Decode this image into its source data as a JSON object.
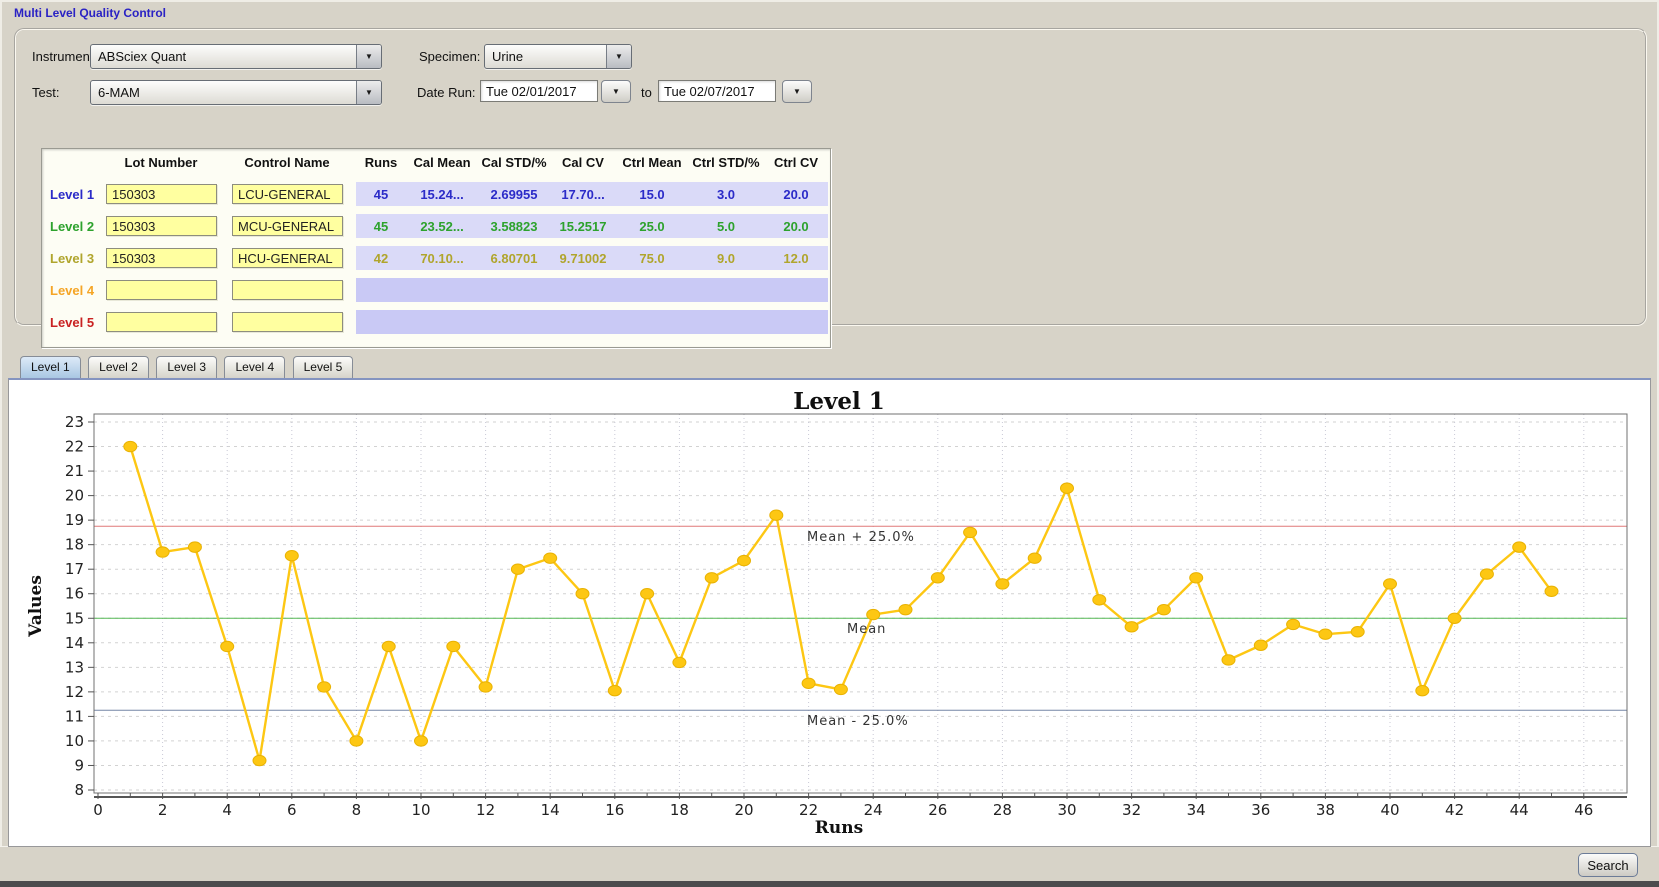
{
  "window": {
    "title": "Multi Level Quality Control"
  },
  "form": {
    "instrument_label": "Instrument:",
    "instrument_value": "ABSciex Quant",
    "specimen_label": "Specimen:",
    "specimen_value": "Urine",
    "test_label": "Test:",
    "test_value": "6-MAM",
    "date_run_label": "Date Run:",
    "date_from": "Tue 02/01/2017",
    "to_label": "to",
    "date_to": "Tue 02/07/2017"
  },
  "table": {
    "headers": [
      "Lot Number",
      "Control Name",
      "Runs",
      "Cal Mean",
      "Cal STD/%",
      "Cal CV",
      "Ctrl Mean",
      "Ctrl STD/%",
      "Ctrl CV"
    ],
    "levels": [
      {
        "label": "Level 1",
        "color": "#2b2bc8",
        "lot": "150303",
        "control_name": "LCU-GENERAL",
        "runs": "45",
        "cal_mean": "15.24...",
        "cal_std": "2.69955",
        "cal_cv": "17.70...",
        "ctrl_mean": "15.0",
        "ctrl_std": "3.0",
        "ctrl_cv": "20.0"
      },
      {
        "label": "Level 2",
        "color": "#2da22d",
        "lot": "150303",
        "control_name": "MCU-GENERAL",
        "runs": "45",
        "cal_mean": "23.52...",
        "cal_std": "3.58823",
        "cal_cv": "15.2517",
        "ctrl_mean": "25.0",
        "ctrl_std": "5.0",
        "ctrl_cv": "20.0"
      },
      {
        "label": "Level 3",
        "color": "#b0a52c",
        "lot": "150303",
        "control_name": "HCU-GENERAL",
        "runs": "42",
        "cal_mean": "70.10...",
        "cal_std": "6.80701",
        "cal_cv": "9.71002",
        "ctrl_mean": "75.0",
        "ctrl_std": "9.0",
        "ctrl_cv": "12.0"
      },
      {
        "label": "Level 4",
        "color": "#f5a526",
        "lot": "",
        "control_name": "",
        "runs": "",
        "cal_mean": "",
        "cal_std": "",
        "cal_cv": "",
        "ctrl_mean": "",
        "ctrl_std": "",
        "ctrl_cv": ""
      },
      {
        "label": "Level 5",
        "color": "#c92222",
        "lot": "",
        "control_name": "",
        "runs": "",
        "cal_mean": "",
        "cal_std": "",
        "cal_cv": "",
        "ctrl_mean": "",
        "ctrl_std": "",
        "ctrl_cv": ""
      }
    ]
  },
  "tabs": [
    {
      "label": "Level 1",
      "selected": true
    },
    {
      "label": "Level 2",
      "selected": false
    },
    {
      "label": "Level 3",
      "selected": false
    },
    {
      "label": "Level 4",
      "selected": false
    },
    {
      "label": "Level 5",
      "selected": false
    }
  ],
  "chart_data": {
    "type": "line",
    "title": "Level 1",
    "xlabel": "Runs",
    "ylabel": "Values",
    "xlim": [
      0,
      46
    ],
    "ylim": [
      8,
      23
    ],
    "x_tick_step": 2,
    "y_tick_step": 1,
    "grid": true,
    "legend": "none",
    "series_color": "#fdc713",
    "x": [
      1,
      2,
      3,
      4,
      5,
      6,
      7,
      8,
      9,
      10,
      11,
      12,
      13,
      14,
      15,
      16,
      17,
      18,
      19,
      20,
      21,
      22,
      23,
      24,
      25,
      26,
      27,
      28,
      29,
      30,
      31,
      32,
      33,
      34,
      35,
      36,
      37,
      38,
      39,
      40,
      41,
      42,
      43,
      44,
      45
    ],
    "values": [
      22.0,
      17.7,
      17.9,
      13.85,
      9.2,
      17.55,
      12.2,
      10.0,
      13.85,
      10.0,
      13.85,
      12.2,
      17.0,
      17.45,
      16.0,
      12.05,
      16.0,
      13.2,
      16.65,
      17.35,
      19.2,
      12.35,
      12.1,
      15.15,
      15.35,
      16.65,
      18.5,
      16.4,
      17.45,
      20.3,
      15.75,
      14.65,
      15.35,
      16.65,
      13.3,
      13.9,
      14.75,
      14.35,
      14.45,
      16.4,
      12.05,
      15.0,
      16.8,
      17.9,
      16.1
    ],
    "ref_lines": [
      {
        "value": 18.75,
        "label": "Mean + 25.0%",
        "color": "#e07878"
      },
      {
        "value": 15.0,
        "label": "Mean",
        "color": "#55b855"
      },
      {
        "value": 11.25,
        "label": "Mean - 25.0%",
        "color": "#7585a5"
      }
    ]
  },
  "footer": {
    "search_label": "Search"
  }
}
